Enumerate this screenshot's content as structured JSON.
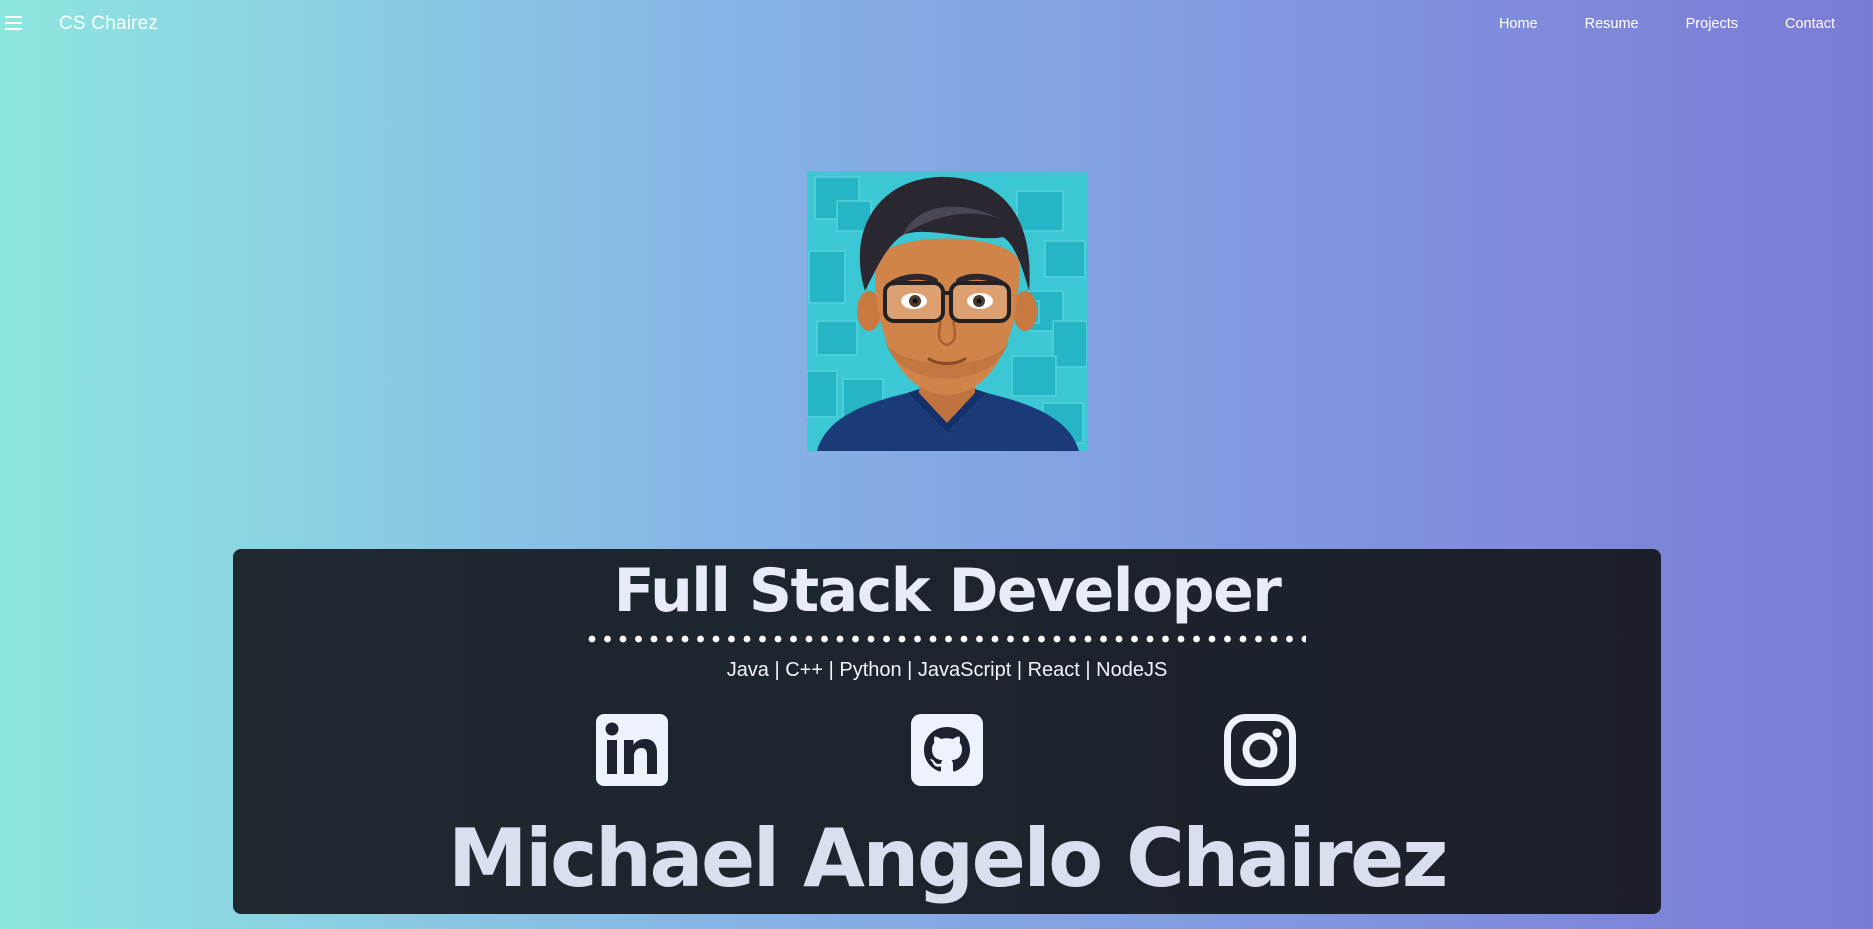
{
  "nav": {
    "brand": "CS Chairez",
    "menu_icon": "hamburger-menu-icon",
    "links": [
      "Home",
      "Resume",
      "Projects",
      "Contact"
    ]
  },
  "profile": {
    "avatar": "cartoon-avatar-portrait"
  },
  "hero": {
    "title": "Full Stack Developer",
    "skills": "Java | C++ | Python | JavaScript | React | NodeJS",
    "name": "Michael Angelo Chairez",
    "social_icons": [
      "linkedin-icon",
      "github-icon",
      "instagram-icon"
    ]
  },
  "colors": {
    "gradient_start": "#8ee6e0",
    "gradient_end": "#7b7bd4",
    "card_bg": "#1c2129",
    "text_light": "#e8ecf8"
  }
}
